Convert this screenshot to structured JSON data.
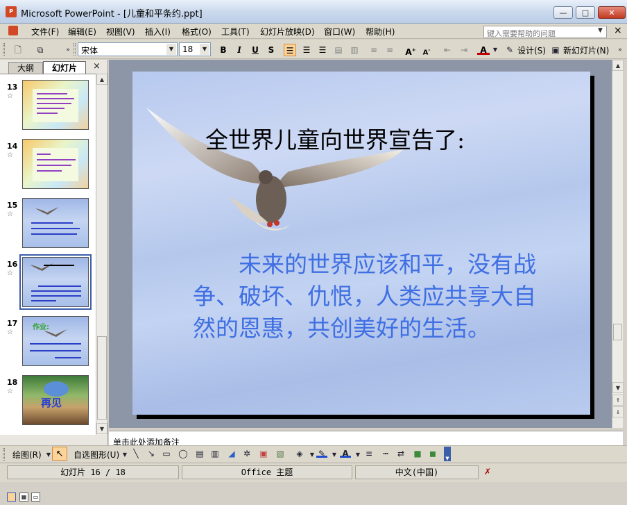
{
  "window": {
    "title": "Microsoft PowerPoint - [儿童和平条约.ppt]",
    "app_icon_text": "P",
    "minimize": "—",
    "maximize": "□",
    "close": "✕"
  },
  "menubar": {
    "items": [
      "文件(F)",
      "编辑(E)",
      "视图(V)",
      "插入(I)",
      "格式(O)",
      "工具(T)",
      "幻灯片放映(D)",
      "窗口(W)",
      "帮助(H)"
    ],
    "help_placeholder": "键入需要帮助的问题",
    "doc_close": "×"
  },
  "toolbar": {
    "font": "宋体",
    "size": "18",
    "bold": "B",
    "italic": "I",
    "underline": "U",
    "shadow": "S",
    "design_label": "设计(S)",
    "new_slide_label": "新幻灯片(N)"
  },
  "leftpanel": {
    "tab_outline": "大纲",
    "tab_slides": "幻灯片",
    "close": "×",
    "slides": [
      {
        "num": "13",
        "star": "☆"
      },
      {
        "num": "14",
        "star": "☆"
      },
      {
        "num": "15",
        "star": "☆"
      },
      {
        "num": "16",
        "star": "☆"
      },
      {
        "num": "17",
        "star": "☆"
      },
      {
        "num": "18",
        "star": "☆"
      }
    ],
    "thumb17_label": "作业:",
    "thumb18_label": "再见"
  },
  "slide": {
    "title": "全世界儿童向世界宣告了:",
    "body": "　　未来的世界应该和平，没有战争、破坏、仇恨，人类应共享大自然的恩惠，共创美好的生活。"
  },
  "notes": {
    "placeholder": "单击此处添加备注"
  },
  "drawbar": {
    "draw_label": "绘图(R)",
    "autoshapes_label": "自选图形(U)"
  },
  "status": {
    "slide_counter": "幻灯片 16 / 18",
    "theme": "Office 主题",
    "language": "中文(中国)"
  },
  "colors": {
    "slide_body_text": "#3f6fe3",
    "selection_border": "#3b5ea8"
  }
}
